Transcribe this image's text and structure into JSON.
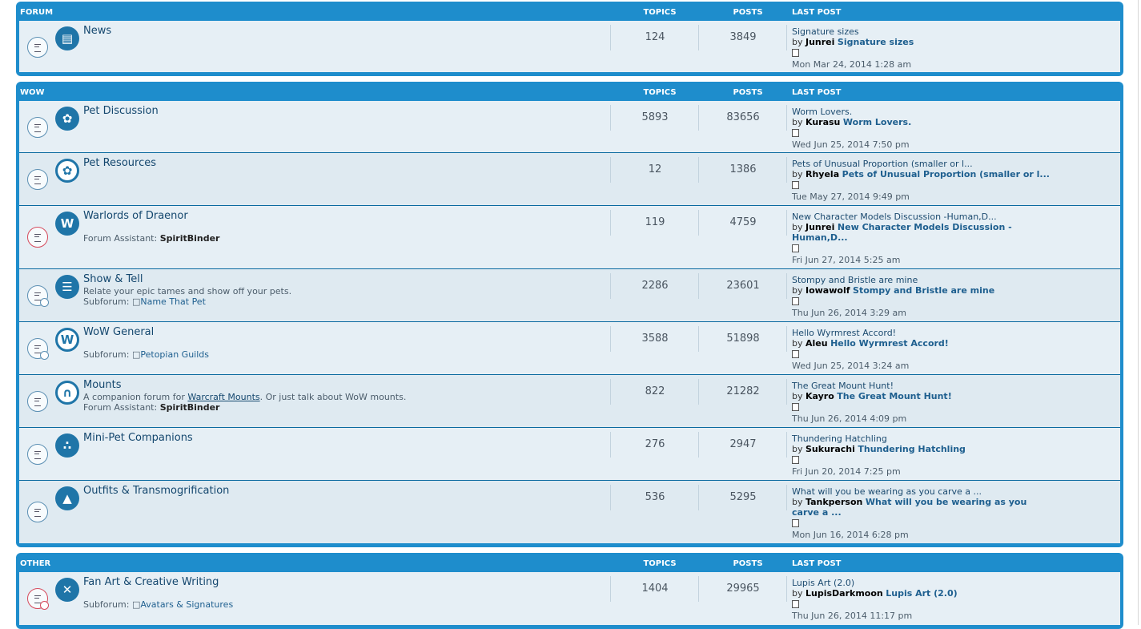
{
  "headers": {
    "topics": "TOPICS",
    "posts": "POSTS",
    "last_post": "LAST POST"
  },
  "sections": [
    {
      "name": "FORUM",
      "forums": [
        {
          "title": "News",
          "icon": "news-icon",
          "status": "read",
          "has_sub": false,
          "topics": "124",
          "posts": "3849",
          "last_title": "Signature sizes",
          "last_by": "by",
          "last_user": "Junrei",
          "last_link": "Signature sizes",
          "last_date": "Mon Mar 24, 2014 1:28 am"
        }
      ]
    },
    {
      "name": "WOW",
      "forums": [
        {
          "title": "Pet Discussion",
          "icon": "paw-icon",
          "status": "read",
          "has_sub": false,
          "topics": "5893",
          "posts": "83656",
          "last_title": "Worm Lovers.",
          "last_by": "by",
          "last_user": "Kurasu",
          "last_link": "Worm Lovers.",
          "last_date": "Wed Jun 25, 2014 7:50 pm"
        },
        {
          "title": "Pet Resources",
          "icon": "paw-icon",
          "status": "read",
          "has_sub": false,
          "topics": "12",
          "posts": "1386",
          "last_title": "Pets of Unusual Proportion (smaller or l...",
          "last_by": "by",
          "last_user": "Rhyela",
          "last_link": "Pets of Unusual Proportion (smaller or l...",
          "last_date": "Tue May 27, 2014 9:49 pm"
        },
        {
          "title": "Warlords of Draenor",
          "icon": "wow-logo-icon",
          "status": "hot",
          "has_sub": false,
          "assistant_label": "Forum Assistant:",
          "assistant": "SpiritBinder",
          "topics": "119",
          "posts": "4759",
          "last_title": "New Character Models Discussion -Human,D...",
          "last_by": "by",
          "last_user": "Junrei",
          "last_link": "New Character Models Discussion -Human,D...",
          "last_date": "Fri Jun 27, 2014 5:25 am"
        },
        {
          "title": "Show & Tell",
          "icon": "book-icon",
          "status": "read",
          "has_sub": true,
          "desc": "Relate your epic tames and show off your pets.",
          "subforum_label": "Subforum:",
          "subforum": "Name That Pet",
          "topics": "2286",
          "posts": "23601",
          "last_title": "Stompy and Bristle are mine",
          "last_by": "by",
          "last_user": "Iowawolf",
          "last_link": "Stompy and Bristle are mine",
          "last_date": "Thu Jun 26, 2014 3:29 am"
        },
        {
          "title": "WoW General",
          "icon": "wow-logo-icon",
          "status": "read",
          "has_sub": true,
          "subforum_label": "Subforum:",
          "subforum": "Petopian Guilds",
          "topics": "3588",
          "posts": "51898",
          "last_title": "Hello Wyrmrest Accord!",
          "last_by": "by",
          "last_user": "Aleu",
          "last_link": "Hello Wyrmrest Accord!",
          "last_date": "Wed Jun 25, 2014 3:24 am"
        },
        {
          "title": "Mounts",
          "icon": "horseshoe-icon",
          "status": "read",
          "has_sub": false,
          "desc_pre": "A companion forum for",
          "desc_link": "Warcraft Mounts",
          "desc_post": ". Or just talk about WoW mounts.",
          "assistant_label": "Forum Assistant:",
          "assistant": "SpiritBinder",
          "topics": "822",
          "posts": "21282",
          "last_title": "The Great Mount Hunt!",
          "last_by": "by",
          "last_user": "Kayro",
          "last_link": "The Great Mount Hunt!",
          "last_date": "Thu Jun 26, 2014 4:09 pm"
        },
        {
          "title": "Mini-Pet Companions",
          "icon": "paws-icon",
          "status": "read",
          "has_sub": false,
          "topics": "276",
          "posts": "2947",
          "last_title": "Thundering Hatchling",
          "last_by": "by",
          "last_user": "Sukurachi",
          "last_link": "Thundering Hatchling",
          "last_date": "Fri Jun 20, 2014 7:25 pm"
        },
        {
          "title": "Outfits & Transmogrification",
          "icon": "shirt-icon",
          "status": "read",
          "has_sub": false,
          "topics": "536",
          "posts": "5295",
          "last_title": "What will you be wearing as you carve a ...",
          "last_by": "by",
          "last_user": "Tankperson",
          "last_link": "What will you be wearing as you carve a ...",
          "last_date": "Mon Jun 16, 2014 6:28 pm"
        }
      ]
    },
    {
      "name": "OTHER",
      "forums": [
        {
          "title": "Fan Art & Creative Writing",
          "icon": "crossed-tools-icon",
          "status": "hot",
          "has_sub": true,
          "subforum_label": "Subforum:",
          "subforum": "Avatars & Signatures",
          "topics": "1404",
          "posts": "29965",
          "last_title": "Lupis Art (2.0)",
          "last_by": "by",
          "last_user": "LupisDarkmoon",
          "last_link": "Lupis Art (2.0)",
          "last_date": "Thu Jun 26, 2014 11:17 pm"
        }
      ]
    }
  ]
}
